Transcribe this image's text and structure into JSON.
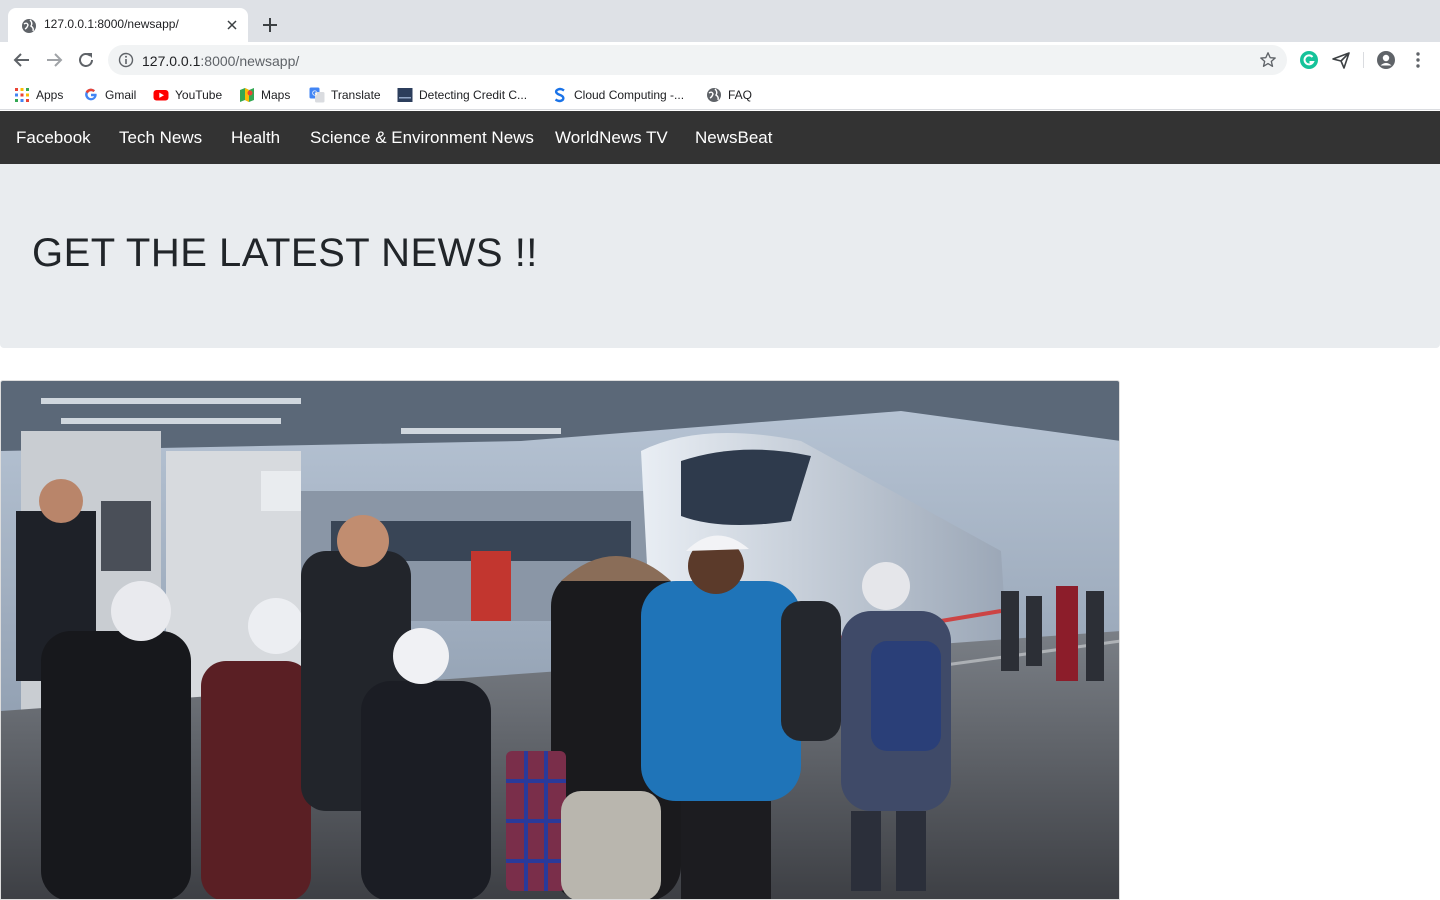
{
  "browser": {
    "tab_title": "127.0.0.1:8000/newsapp/",
    "url_host": "127.0.0.1",
    "url_rest": ":8000/newsapp/",
    "bookmarks": [
      {
        "label": "Apps",
        "icon": "apps-grid-icon"
      },
      {
        "label": "Gmail",
        "icon": "google-icon"
      },
      {
        "label": "YouTube",
        "icon": "youtube-icon"
      },
      {
        "label": "Maps",
        "icon": "maps-icon"
      },
      {
        "label": "Translate",
        "icon": "translate-icon"
      },
      {
        "label": "Detecting Credit C...",
        "icon": "page-thumbnail-icon"
      },
      {
        "label": "Cloud Computing -...",
        "icon": "s-logo-icon"
      },
      {
        "label": "FAQ",
        "icon": "globe-icon"
      }
    ]
  },
  "site": {
    "nav": [
      "Facebook",
      "Tech News",
      "Health",
      "Science & Environment News",
      "WorldNews TV",
      "NewsBeat"
    ],
    "headline": "GET THE LATEST NEWS !!"
  },
  "colors": {
    "navbar": "#333333",
    "hero": "#e9ecef",
    "tabstrip": "#dee1e6"
  }
}
